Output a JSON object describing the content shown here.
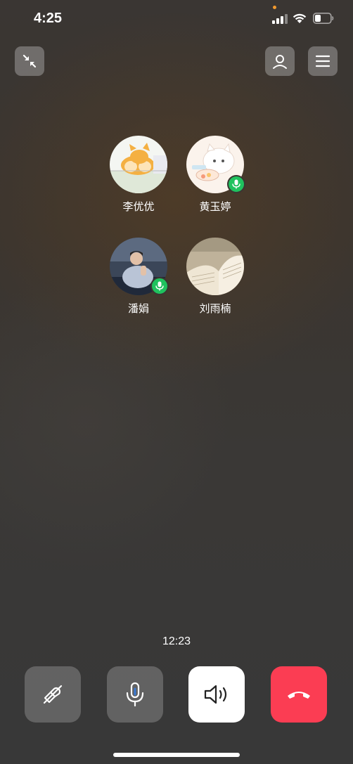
{
  "status_bar": {
    "time": "4:25",
    "icons": [
      "signal-icon",
      "wifi-icon",
      "battery-icon"
    ],
    "privacy_dot_color": "#f29a2e"
  },
  "top_bar": {
    "left_button_icon": "minimize-icon",
    "right_buttons": [
      "add-member-icon",
      "menu-icon"
    ]
  },
  "participants": [
    {
      "name": "李优优",
      "avatar": "corgi-cartoon",
      "speaking": false
    },
    {
      "name": "黄玉婷",
      "avatar": "cat-cartoon",
      "speaking": true
    },
    {
      "name": "潘娟",
      "avatar": "man-photo",
      "speaking": true
    },
    {
      "name": "刘雨楠",
      "avatar": "book-photo",
      "speaking": false
    }
  ],
  "call": {
    "duration": "12:23"
  },
  "controls": [
    {
      "name": "camera-off",
      "icon": "camera-off-icon"
    },
    {
      "name": "microphone",
      "icon": "microphone-icon"
    },
    {
      "name": "speaker",
      "icon": "speaker-icon"
    },
    {
      "name": "hang-up",
      "icon": "hang-up-icon"
    }
  ],
  "colors": {
    "speaking_badge": "#1fc25e",
    "hang_up": "#fb3d53",
    "mic_accent": "#3a7bd5"
  }
}
